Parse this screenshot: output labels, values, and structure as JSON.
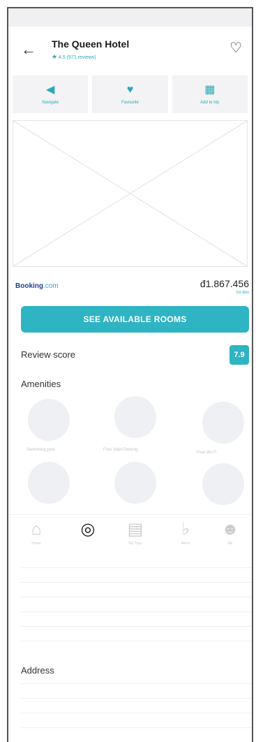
{
  "header": {
    "back_icon": "arrow-left-icon",
    "title": "The Queen Hotel",
    "rating_text": "4.5 (971 reviews)",
    "favorite_icon": "heart-outline-icon"
  },
  "actions": [
    {
      "label": "Navigate",
      "icon": "navigate-icon"
    },
    {
      "label": "Favourite",
      "icon": "heart-icon"
    },
    {
      "label": "Add to trip",
      "icon": "calendar-icon"
    }
  ],
  "booking": {
    "provider_main": "Booking",
    "provider_suffix": ".com",
    "price": "đ1.867.456",
    "price_note": "5/2 đêm"
  },
  "cta": {
    "label": "SEE AVAILABLE ROOMS"
  },
  "review": {
    "label": "Review score",
    "score": "7.9"
  },
  "amenities": {
    "title": "Amenities",
    "items": [
      "Swimming pool",
      "Free Valet Parking",
      "Free Wi-Fi",
      "",
      "",
      ""
    ]
  },
  "tabbar": [
    {
      "label": "Home",
      "icon": "home-icon"
    },
    {
      "label": "",
      "icon": "target-icon"
    },
    {
      "label": "My Trips",
      "icon": "trips-icon"
    },
    {
      "label": "Alerts",
      "icon": "bell-icon"
    },
    {
      "label": "Me",
      "icon": "user-icon"
    }
  ],
  "address": {
    "label": "Address"
  },
  "colors": {
    "accent": "#2eb4c2",
    "brand_booking": "#1e3f8f"
  }
}
